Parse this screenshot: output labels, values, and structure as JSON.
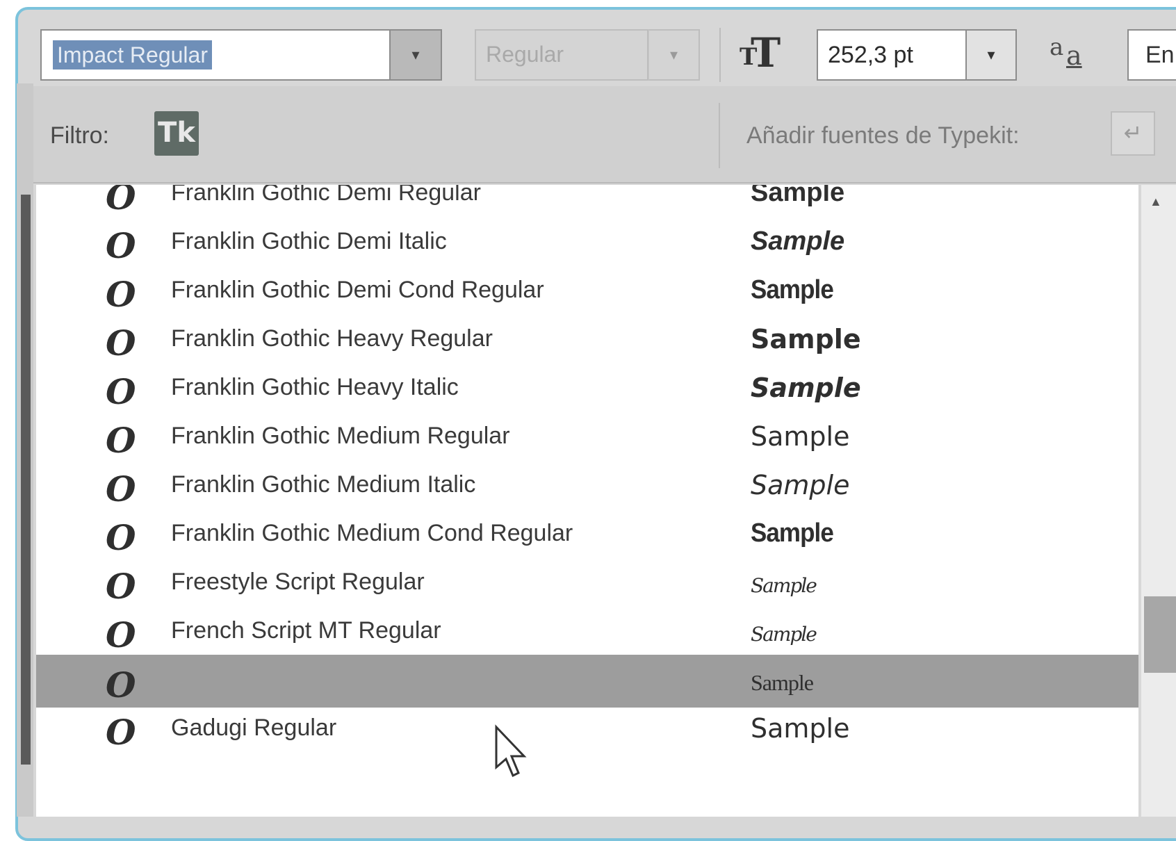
{
  "toolbar": {
    "font_family_value": "Impact Regular",
    "font_style_value": "Regular",
    "font_size_value": "252,3 pt",
    "language_value": "En",
    "dropdown_arrow": "▾"
  },
  "filter": {
    "label": "Filtro:",
    "typekit_filter_glyph": "Tk",
    "add_typekit_label": "Añadir fuentes de Typekit:",
    "typekit_add_glyph": "↵"
  },
  "fonts": [
    {
      "name": "Franklin Gothic Demi Regular",
      "sample": "Sample",
      "style": "bold"
    },
    {
      "name": "Franklin Gothic Demi Italic",
      "sample": "Sample",
      "style": "bolditalic"
    },
    {
      "name": "Franklin Gothic Demi Cond Regular",
      "sample": "Sample",
      "style": "bold-cond"
    },
    {
      "name": "Franklin Gothic Heavy Regular",
      "sample": "Sample",
      "style": "heavy"
    },
    {
      "name": "Franklin Gothic Heavy Italic",
      "sample": "Sample",
      "style": "heavyitalic"
    },
    {
      "name": "Franklin Gothic Medium Regular",
      "sample": "Sample",
      "style": "regular"
    },
    {
      "name": "Franklin Gothic Medium Italic",
      "sample": "Sample",
      "style": "italic"
    },
    {
      "name": "Franklin Gothic Medium Cond Regular",
      "sample": "Sample",
      "style": "bold-cond"
    },
    {
      "name": "Freestyle Script Regular",
      "sample": "Sample",
      "style": "script"
    },
    {
      "name": "French Script MT Regular",
      "sample": "Sample",
      "style": "script"
    },
    {
      "name": "",
      "sample": "Sample",
      "style": "fontstyle",
      "selected": true
    },
    {
      "name": "Gadugi Regular",
      "sample": "Sample",
      "style": "regular"
    }
  ],
  "font_icon_glyph": "O",
  "colors": {
    "frame_accent": "#7cc3dc",
    "selection_highlight": "#6f8fb8",
    "selected_row": "#9d9d9d"
  }
}
